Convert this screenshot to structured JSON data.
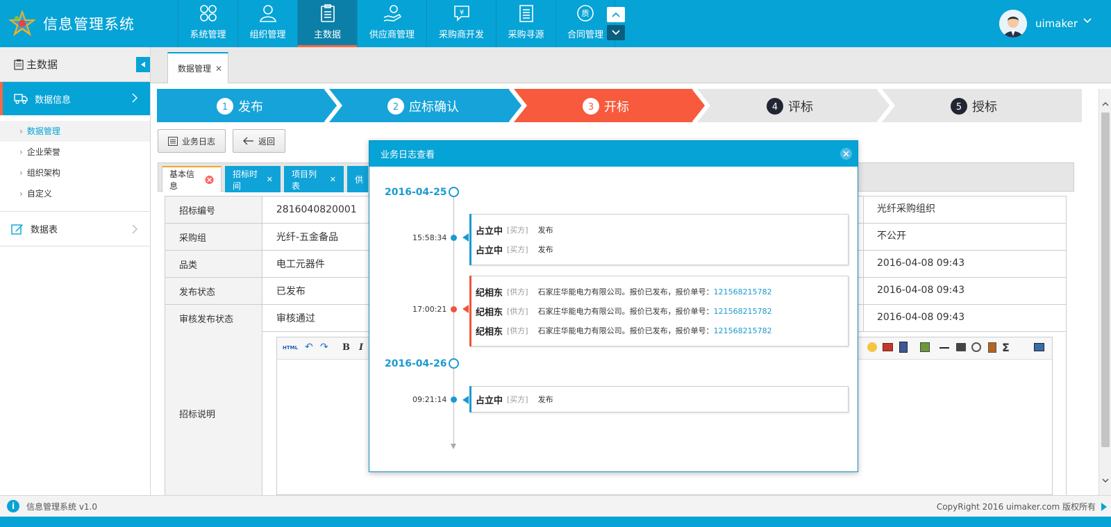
{
  "app": {
    "title": "信息管理系统",
    "user": "uimaker"
  },
  "nav": [
    {
      "label": "系统管理",
      "icon": "grid-icon"
    },
    {
      "label": "组织管理",
      "icon": "person-icon"
    },
    {
      "label": "主数据",
      "icon": "clipboard-icon",
      "active": true
    },
    {
      "label": "供应商管理",
      "icon": "hand-coin-icon"
    },
    {
      "label": "采购商开发",
      "icon": "yen-chat-icon"
    },
    {
      "label": "采购寻源",
      "icon": "document-icon"
    },
    {
      "label": "合同管理",
      "icon": "quality-badge-icon"
    }
  ],
  "sidebar": {
    "title": "主数据",
    "group1": "数据信息",
    "items": [
      "数据管理",
      "企业荣誉",
      "组织架构",
      "自定义"
    ],
    "group2": "数据表"
  },
  "page_tab": "数据管理",
  "steps": [
    {
      "num": "1",
      "label": "发布",
      "state": "done"
    },
    {
      "num": "2",
      "label": "应标确认",
      "state": "done"
    },
    {
      "num": "3",
      "label": "开标",
      "state": "current"
    },
    {
      "num": "4",
      "label": "评标",
      "state": "todo"
    },
    {
      "num": "5",
      "label": "授标",
      "state": "todo"
    }
  ],
  "toolbar": {
    "log": "业务日志",
    "back": "返回"
  },
  "subtabs": [
    "基本信息",
    "招标时间",
    "项目列表",
    "供"
  ],
  "form": {
    "rows": [
      {
        "label": "招标编号",
        "value": "2816040820001",
        "right": "光纤采购组织"
      },
      {
        "label": "采购组",
        "value": "光纤-五金备品",
        "right": "不公开"
      },
      {
        "label": "品类",
        "value": "电工元器件",
        "right": "2016-04-08 09:43"
      },
      {
        "label": "发布状态",
        "value": "已发布",
        "right": "2016-04-08 09:43"
      },
      {
        "label": "审核发布状态",
        "value": "审核通过",
        "right": "2016-04-08 09:43"
      }
    ],
    "desc_label": "招标说明",
    "editor_html_label": "HTML"
  },
  "modal": {
    "title": "业务日志查看",
    "dates": [
      "2016-04-25",
      "2016-04-26"
    ],
    "groups": [
      {
        "time": "15:58:34",
        "color": "#1a9ad0",
        "entries": [
          {
            "who": "占立中",
            "role": "[买方]",
            "action": "发布",
            "num": ""
          },
          {
            "who": "占立中",
            "role": "[买方]",
            "action": "发布",
            "num": ""
          }
        ]
      },
      {
        "time": "17:00:21",
        "color": "#f0533a",
        "entries": [
          {
            "who": "纪相东",
            "role": "[供方]",
            "action": "石家庄华能电力有限公司。报价已发布，报价单号：",
            "num": "121568215782"
          },
          {
            "who": "纪相东",
            "role": "[供方]",
            "action": "石家庄华能电力有限公司。报价已发布，报价单号：",
            "num": "121568215782"
          },
          {
            "who": "纪相东",
            "role": "[供方]",
            "action": "石家庄华能电力有限公司。报价已发布，报价单号：",
            "num": "121568215782"
          }
        ]
      },
      {
        "time": "09:21:14",
        "color": "#1a9ad0",
        "entries": [
          {
            "who": "占立中",
            "role": "[买方]",
            "action": "发布",
            "num": ""
          }
        ]
      }
    ]
  },
  "footer": {
    "version": "信息管理系统 v1.0",
    "copyright": "CopyRight 2016  uimaker.com 版权所有"
  },
  "colors": {
    "primary": "#06a3d6",
    "accent": "#f56a46",
    "todo": "#e6e6e6"
  }
}
